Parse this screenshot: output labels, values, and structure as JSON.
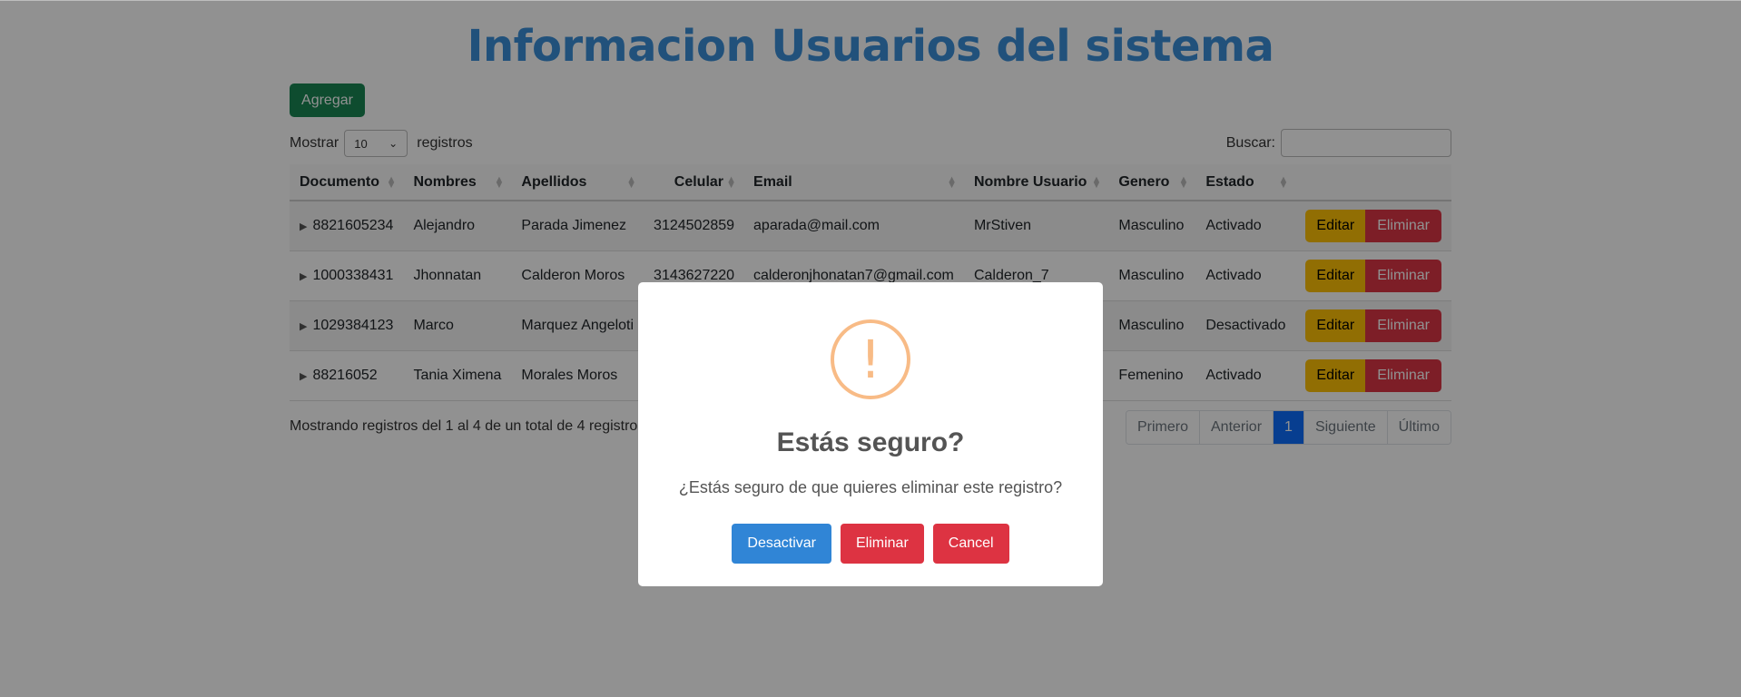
{
  "page": {
    "title": "Informacion Usuarios del sistema",
    "add_label": "Agregar"
  },
  "controls": {
    "show_label": "Mostrar",
    "show_value": "10",
    "records_label": "registros",
    "search_label": "Buscar:",
    "search_value": ""
  },
  "table": {
    "headers": [
      "Documento",
      "Nombres",
      "Apellidos",
      "Celular",
      "Email",
      "Nombre Usuario",
      "Genero",
      "Estado"
    ],
    "rows": [
      {
        "documento": "8821605234",
        "nombres": "Alejandro",
        "apellidos": "Parada Jimenez",
        "celular": "3124502859",
        "email": "aparada@mail.com",
        "usuario": "MrStiven",
        "genero": "Masculino",
        "estado": "Activado"
      },
      {
        "documento": "1000338431",
        "nombres": "Jhonnatan",
        "apellidos": "Calderon Moros",
        "celular": "3143627220",
        "email": "calderonjhonatan7@gmail.com",
        "usuario": "Calderon_7",
        "genero": "Masculino",
        "estado": "Activado"
      },
      {
        "documento": "1029384123",
        "nombres": "Marco",
        "apellidos": "Marquez Angeloti",
        "celular": "",
        "email": "",
        "usuario": "",
        "genero": "Masculino",
        "estado": "Desactivado"
      },
      {
        "documento": "88216052",
        "nombres": "Tania Ximena",
        "apellidos": "Morales Moros",
        "celular": "",
        "email": "",
        "usuario": "",
        "genero": "Femenino",
        "estado": "Activado"
      }
    ],
    "edit_label": "Editar",
    "delete_label": "Eliminar"
  },
  "footer": {
    "info": "Mostrando registros del 1 al 4 de un total de 4 registros",
    "pagination": [
      "Primero",
      "Anterior",
      "1",
      "Siguiente",
      "Último"
    ]
  },
  "modal": {
    "icon": "!",
    "title": "Estás seguro?",
    "text": "¿Estás seguro de que quieres eliminar este registro?",
    "deactivate_label": "Desactivar",
    "delete_label": "Eliminar",
    "cancel_label": "Cancel"
  },
  "colors": {
    "title": "#3a8fd9",
    "add_button": "#198754",
    "edit_button": "#ffc107",
    "delete_button": "#dc3545",
    "active_page": "#0d6efd",
    "warning_icon": "#f8bb86",
    "modal_blue": "#3085d6",
    "modal_red": "#dd3342"
  }
}
